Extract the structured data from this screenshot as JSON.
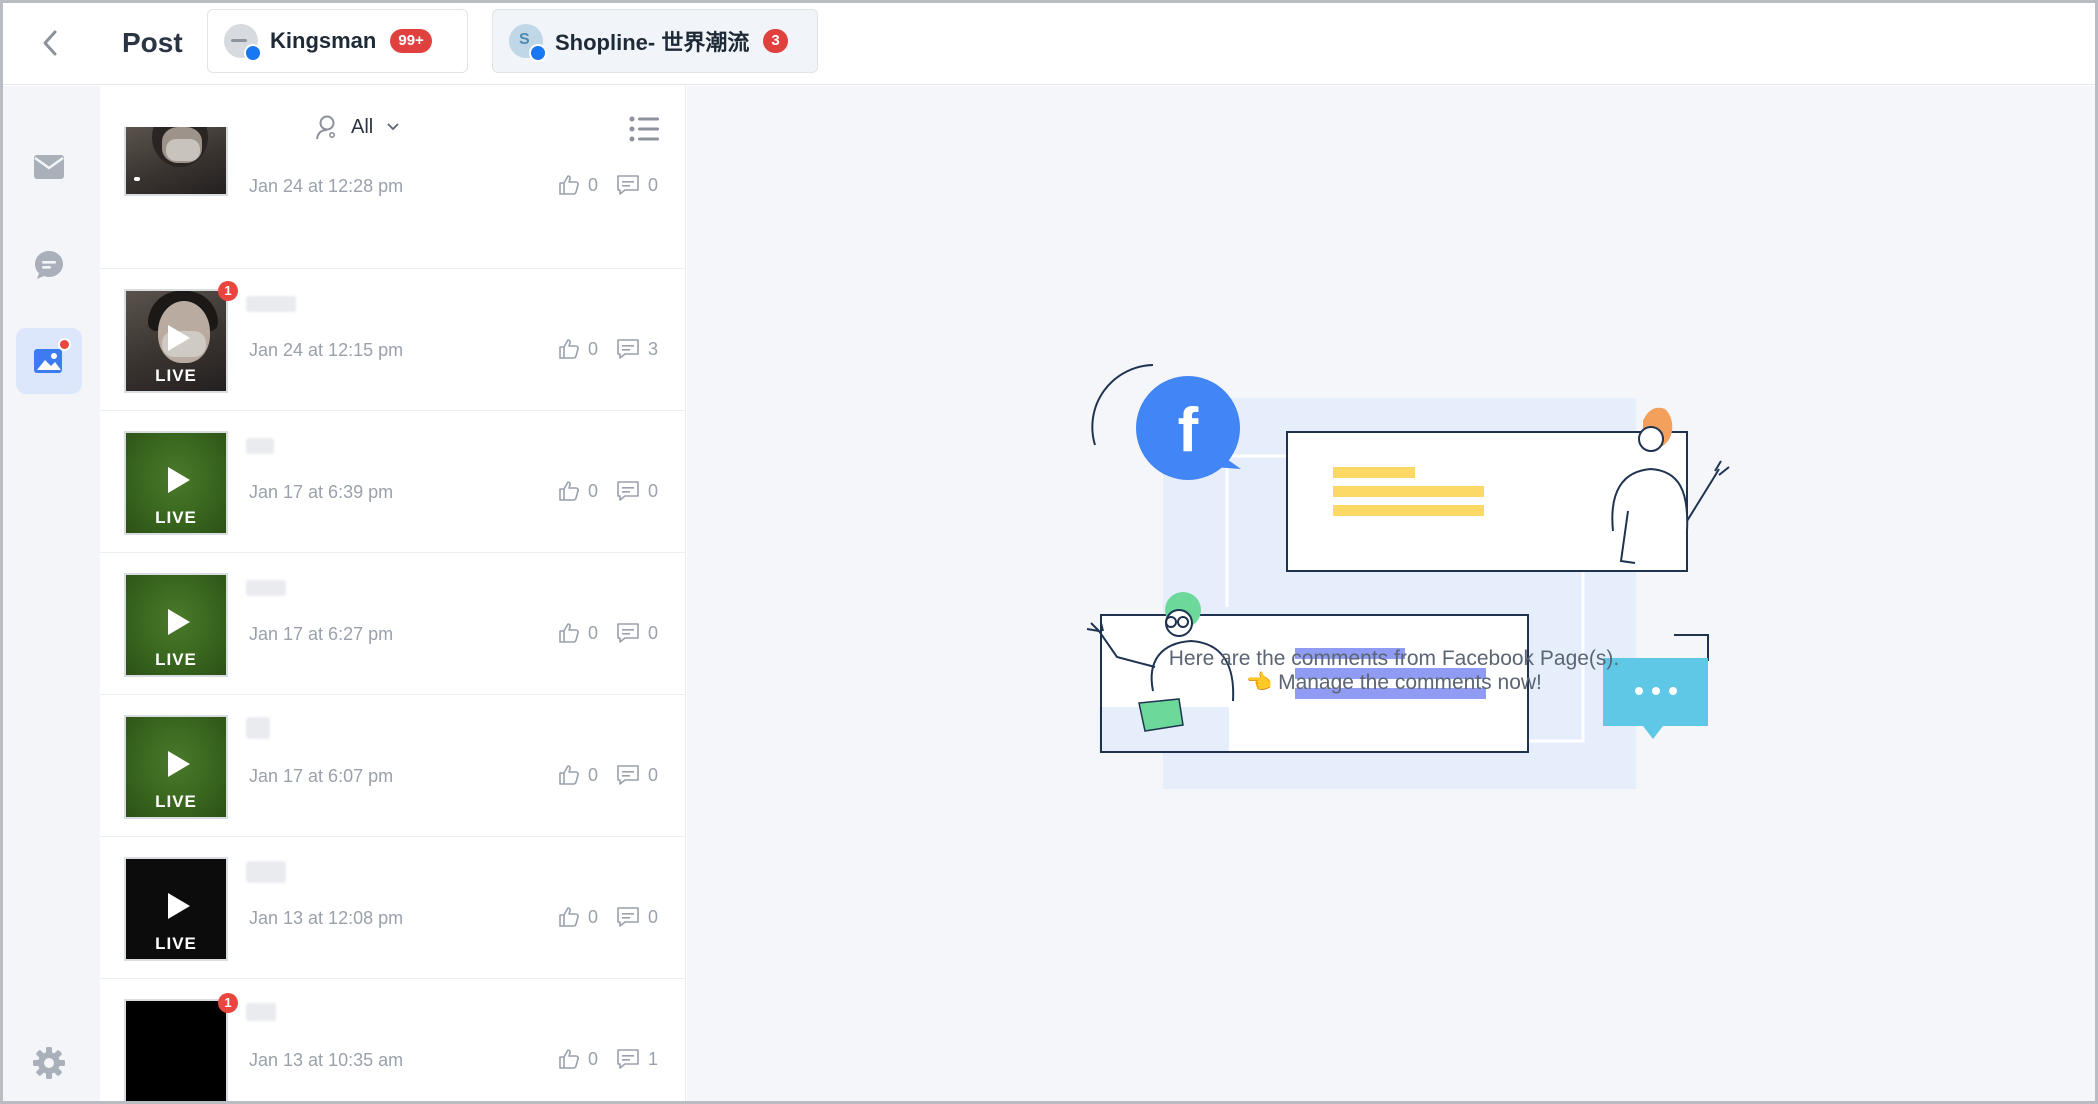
{
  "header": {
    "title": "Post",
    "tabs": [
      {
        "label": "Kingsman",
        "badge": "99+"
      },
      {
        "label": "Shopline- 世界潮流",
        "badge": "3"
      }
    ]
  },
  "filter": {
    "label": "All"
  },
  "posts": [
    {
      "date": "Jan 24 at 12:28 pm",
      "likes": "0",
      "comments": "0",
      "live": ""
    },
    {
      "date": "Jan 24 at 12:15 pm",
      "likes": "0",
      "comments": "3",
      "live": "LIVE",
      "unread": "1"
    },
    {
      "date": "Jan 17 at 6:39 pm",
      "likes": "0",
      "comments": "0",
      "live": "LIVE"
    },
    {
      "date": "Jan 17 at 6:27 pm",
      "likes": "0",
      "comments": "0",
      "live": "LIVE"
    },
    {
      "date": "Jan 17 at 6:07 pm",
      "likes": "0",
      "comments": "0",
      "live": "LIVE"
    },
    {
      "date": "Jan 13 at 12:08 pm",
      "likes": "0",
      "comments": "0",
      "live": "LIVE"
    },
    {
      "date": "Jan 13 at 10:35 am",
      "likes": "0",
      "comments": "1",
      "live": "",
      "unread": "1"
    }
  ],
  "empty_state": {
    "line1": "Here are the comments from Facebook Page(s).",
    "line2": "👈 Manage the comments now!"
  },
  "colors": {
    "facebook": "#4285f4",
    "badge_red": "#e0413f",
    "accent_blue": "#dde7fb",
    "chat_bubble": "#5ec8e6"
  }
}
